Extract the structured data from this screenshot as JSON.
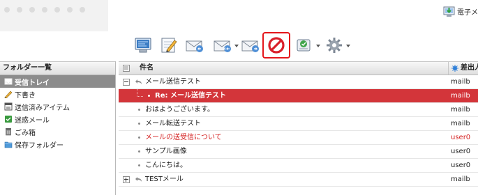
{
  "header": {
    "top_link_label": "電子メ",
    "top_link_icon": "download-computer-icon"
  },
  "toolbar": {
    "buttons": [
      {
        "name": "check-mail-button",
        "icon": "inbox-computer-icon"
      },
      {
        "name": "compose-button",
        "icon": "pencil-memo-icon"
      },
      {
        "name": "reply-button",
        "icon": "envelope-reply-icon"
      },
      {
        "name": "reply-all-button",
        "icon": "envelope-reply-all-icon",
        "dropdown": true
      },
      {
        "name": "forward-button",
        "icon": "envelope-forward-icon"
      },
      {
        "name": "block-button",
        "icon": "prohibited-icon",
        "highlighted": true
      },
      {
        "name": "spam-filter-button",
        "icon": "spam-check-icon",
        "dropdown": true
      },
      {
        "name": "settings-button",
        "icon": "gear-icon",
        "dropdown": true
      }
    ],
    "highlight_color": "#e4161b"
  },
  "folders": {
    "header": "フォルダー一覧",
    "items": [
      {
        "label": "受信トレイ",
        "icon": "inbox-icon",
        "selected": true
      },
      {
        "label": "下書き",
        "icon": "pencil-icon"
      },
      {
        "label": "送信済みアイテム",
        "icon": "sent-items-icon"
      },
      {
        "label": "迷惑メール",
        "icon": "junk-mail-icon"
      },
      {
        "label": "ごみ箱",
        "icon": "trash-icon"
      },
      {
        "label": "保存フォルダー",
        "icon": "folder-icon"
      }
    ]
  },
  "message_list": {
    "columns": {
      "subject": "件名",
      "sender": "差出人"
    },
    "rows": [
      {
        "subject": "メール送信テスト",
        "sender": "mailb",
        "expander": "minus",
        "replied": true,
        "level": 0
      },
      {
        "subject": "Re: メール送信テスト",
        "sender": "mailb",
        "level": 1,
        "selected": true
      },
      {
        "subject": "おはようございます。",
        "sender": "mailb",
        "level": 0
      },
      {
        "subject": "メール転送テスト",
        "sender": "mailb",
        "level": 0
      },
      {
        "subject": "メールの送受信について",
        "sender": "user0",
        "level": 0,
        "unread_red": true
      },
      {
        "subject": "サンプル画像",
        "sender": "user0",
        "level": 0
      },
      {
        "subject": "こんにちは。",
        "sender": "user0",
        "level": 0
      },
      {
        "subject": "TESTメール",
        "sender": "mailb",
        "expander": "plus",
        "replied": true,
        "level": 0
      }
    ],
    "selected_row_color": "#d3353a",
    "unread_text_color": "#d41e1e"
  }
}
